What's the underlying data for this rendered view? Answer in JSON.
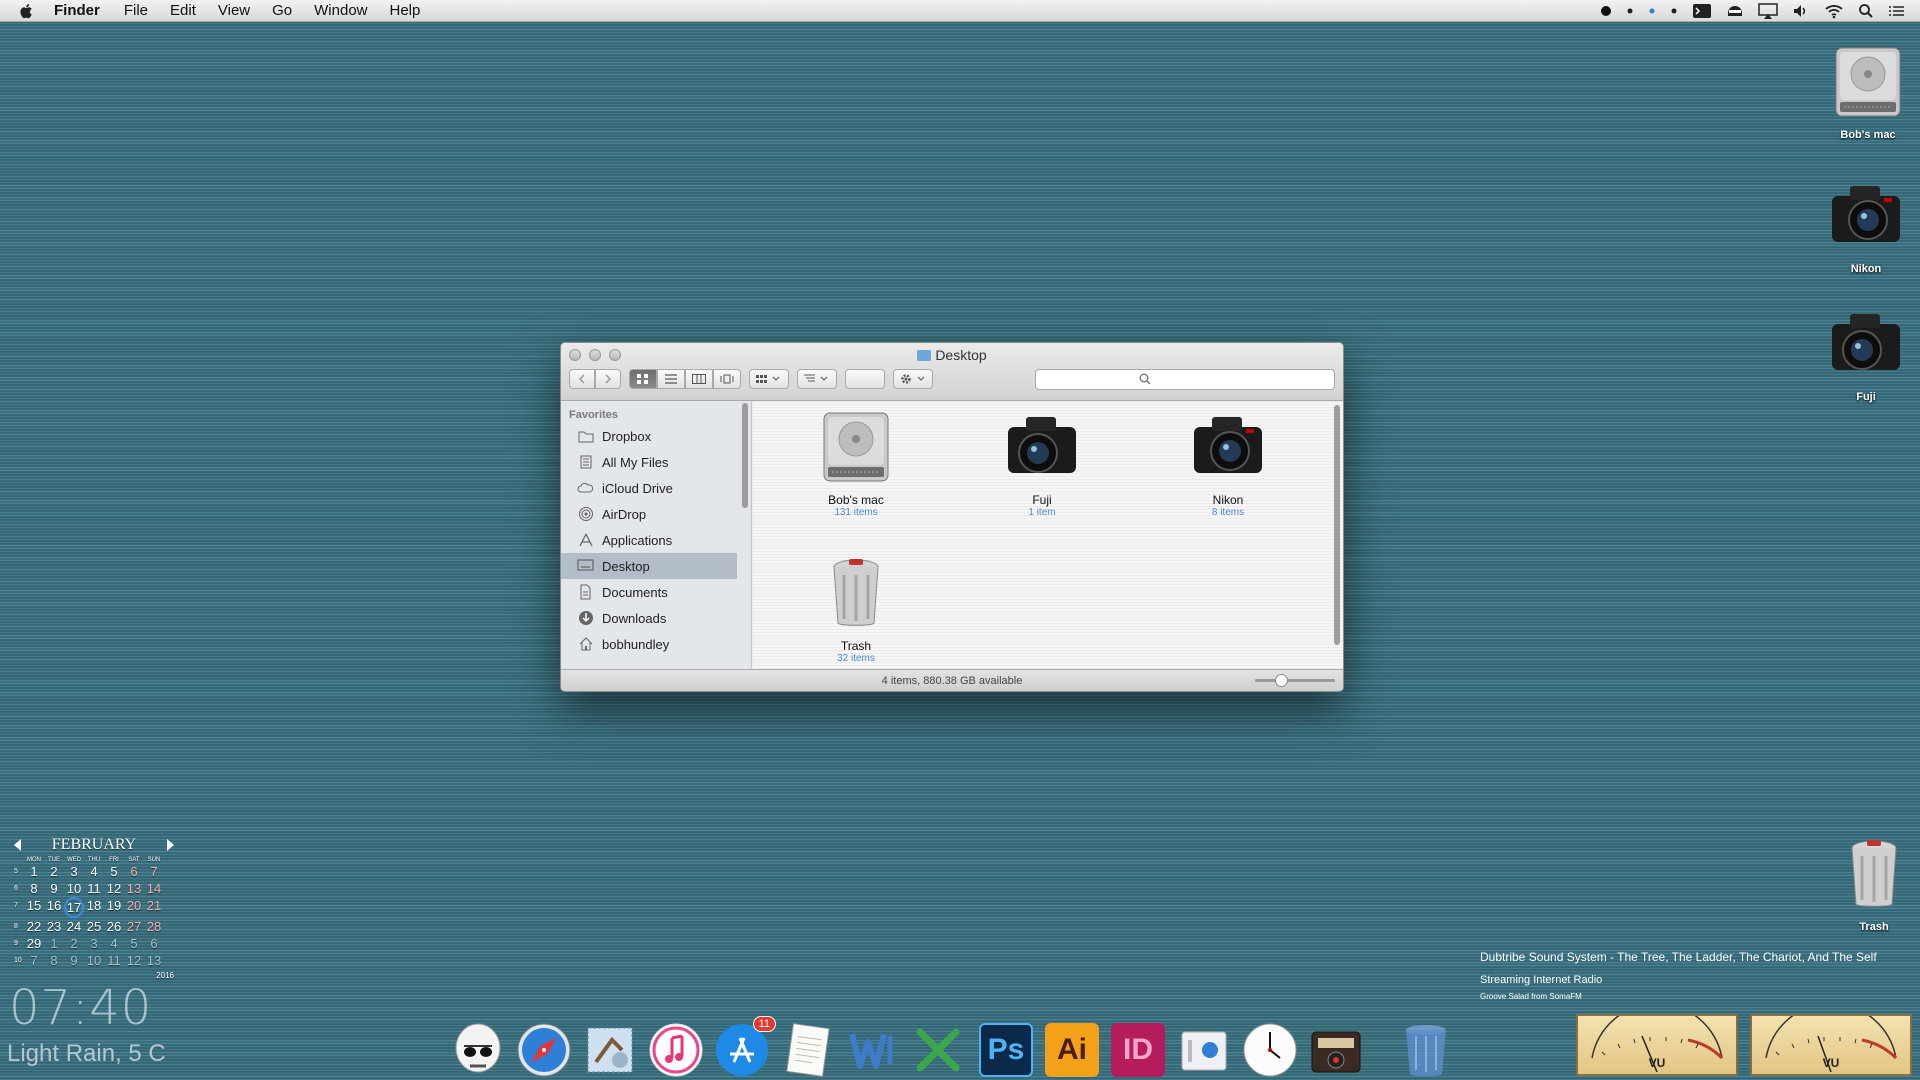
{
  "menubar": {
    "app_name": "Finder",
    "items": [
      "File",
      "Edit",
      "View",
      "Go",
      "Window",
      "Help"
    ]
  },
  "desktop_icons": {
    "bobs_mac": "Bob's mac",
    "nikon": "Nikon",
    "fuji": "Fuji",
    "trash": "Trash"
  },
  "window": {
    "title": "Desktop",
    "search_placeholder": "",
    "sidebar_section": "Favorites",
    "sidebar": [
      {
        "label": "Dropbox",
        "icon": "folder-icon"
      },
      {
        "label": "All My Files",
        "icon": "all-files-icon"
      },
      {
        "label": "iCloud Drive",
        "icon": "cloud-icon"
      },
      {
        "label": "AirDrop",
        "icon": "airdrop-icon"
      },
      {
        "label": "Applications",
        "icon": "applications-icon"
      },
      {
        "label": "Desktop",
        "icon": "desktop-icon",
        "selected": true
      },
      {
        "label": "Documents",
        "icon": "documents-icon"
      },
      {
        "label": "Downloads",
        "icon": "downloads-icon"
      },
      {
        "label": "bobhundley",
        "icon": "home-icon"
      }
    ],
    "items": [
      {
        "name": "Bob's mac",
        "sub": "131 items"
      },
      {
        "name": "Fuji",
        "sub": "1 item"
      },
      {
        "name": "Nikon",
        "sub": "8 items"
      },
      {
        "name": "Trash",
        "sub": "32 items"
      }
    ],
    "status": "4 items, 880.38 GB available",
    "zoom_level": 0.3
  },
  "calendar": {
    "month": "FEBRUARY",
    "days": [
      "MON",
      "TUE",
      "WED",
      "THU",
      "FRI",
      "SAT",
      "SUN"
    ],
    "weeks": [
      {
        "wk": "5",
        "d": [
          "1",
          "2",
          "3",
          "4",
          "5",
          "6",
          "7"
        ]
      },
      {
        "wk": "6",
        "d": [
          "8",
          "9",
          "10",
          "11",
          "12",
          "13",
          "14"
        ]
      },
      {
        "wk": "7",
        "d": [
          "15",
          "16",
          "17",
          "18",
          "19",
          "20",
          "21"
        ]
      },
      {
        "wk": "8",
        "d": [
          "22",
          "23",
          "24",
          "25",
          "26",
          "27",
          "28"
        ]
      },
      {
        "wk": "9",
        "d": [
          "29",
          "1",
          "2",
          "3",
          "4",
          "5",
          "6"
        ]
      },
      {
        "wk": "10",
        "d": [
          "7",
          "8",
          "9",
          "10",
          "11",
          "12",
          "13"
        ]
      }
    ],
    "today": "17",
    "year": "2016"
  },
  "clock": "07:40",
  "weather": "Light Rain, 5 C",
  "now_playing": {
    "track": "Dubtribe Sound System - The Tree, The Ladder, The Chariot, And The Self",
    "source": "Streaming Internet Radio",
    "station": "Groove Salad from SomaFM",
    "vu_label": "VU"
  },
  "dock": {
    "badge_app_store": "11",
    "ps": "Ps",
    "ai": "Ai",
    "id": "ID"
  },
  "colors": {
    "desktop": "#3f7584",
    "selection": "#b3bcc9",
    "accent": "#4a8bd0",
    "badge": "#e23b2e"
  }
}
